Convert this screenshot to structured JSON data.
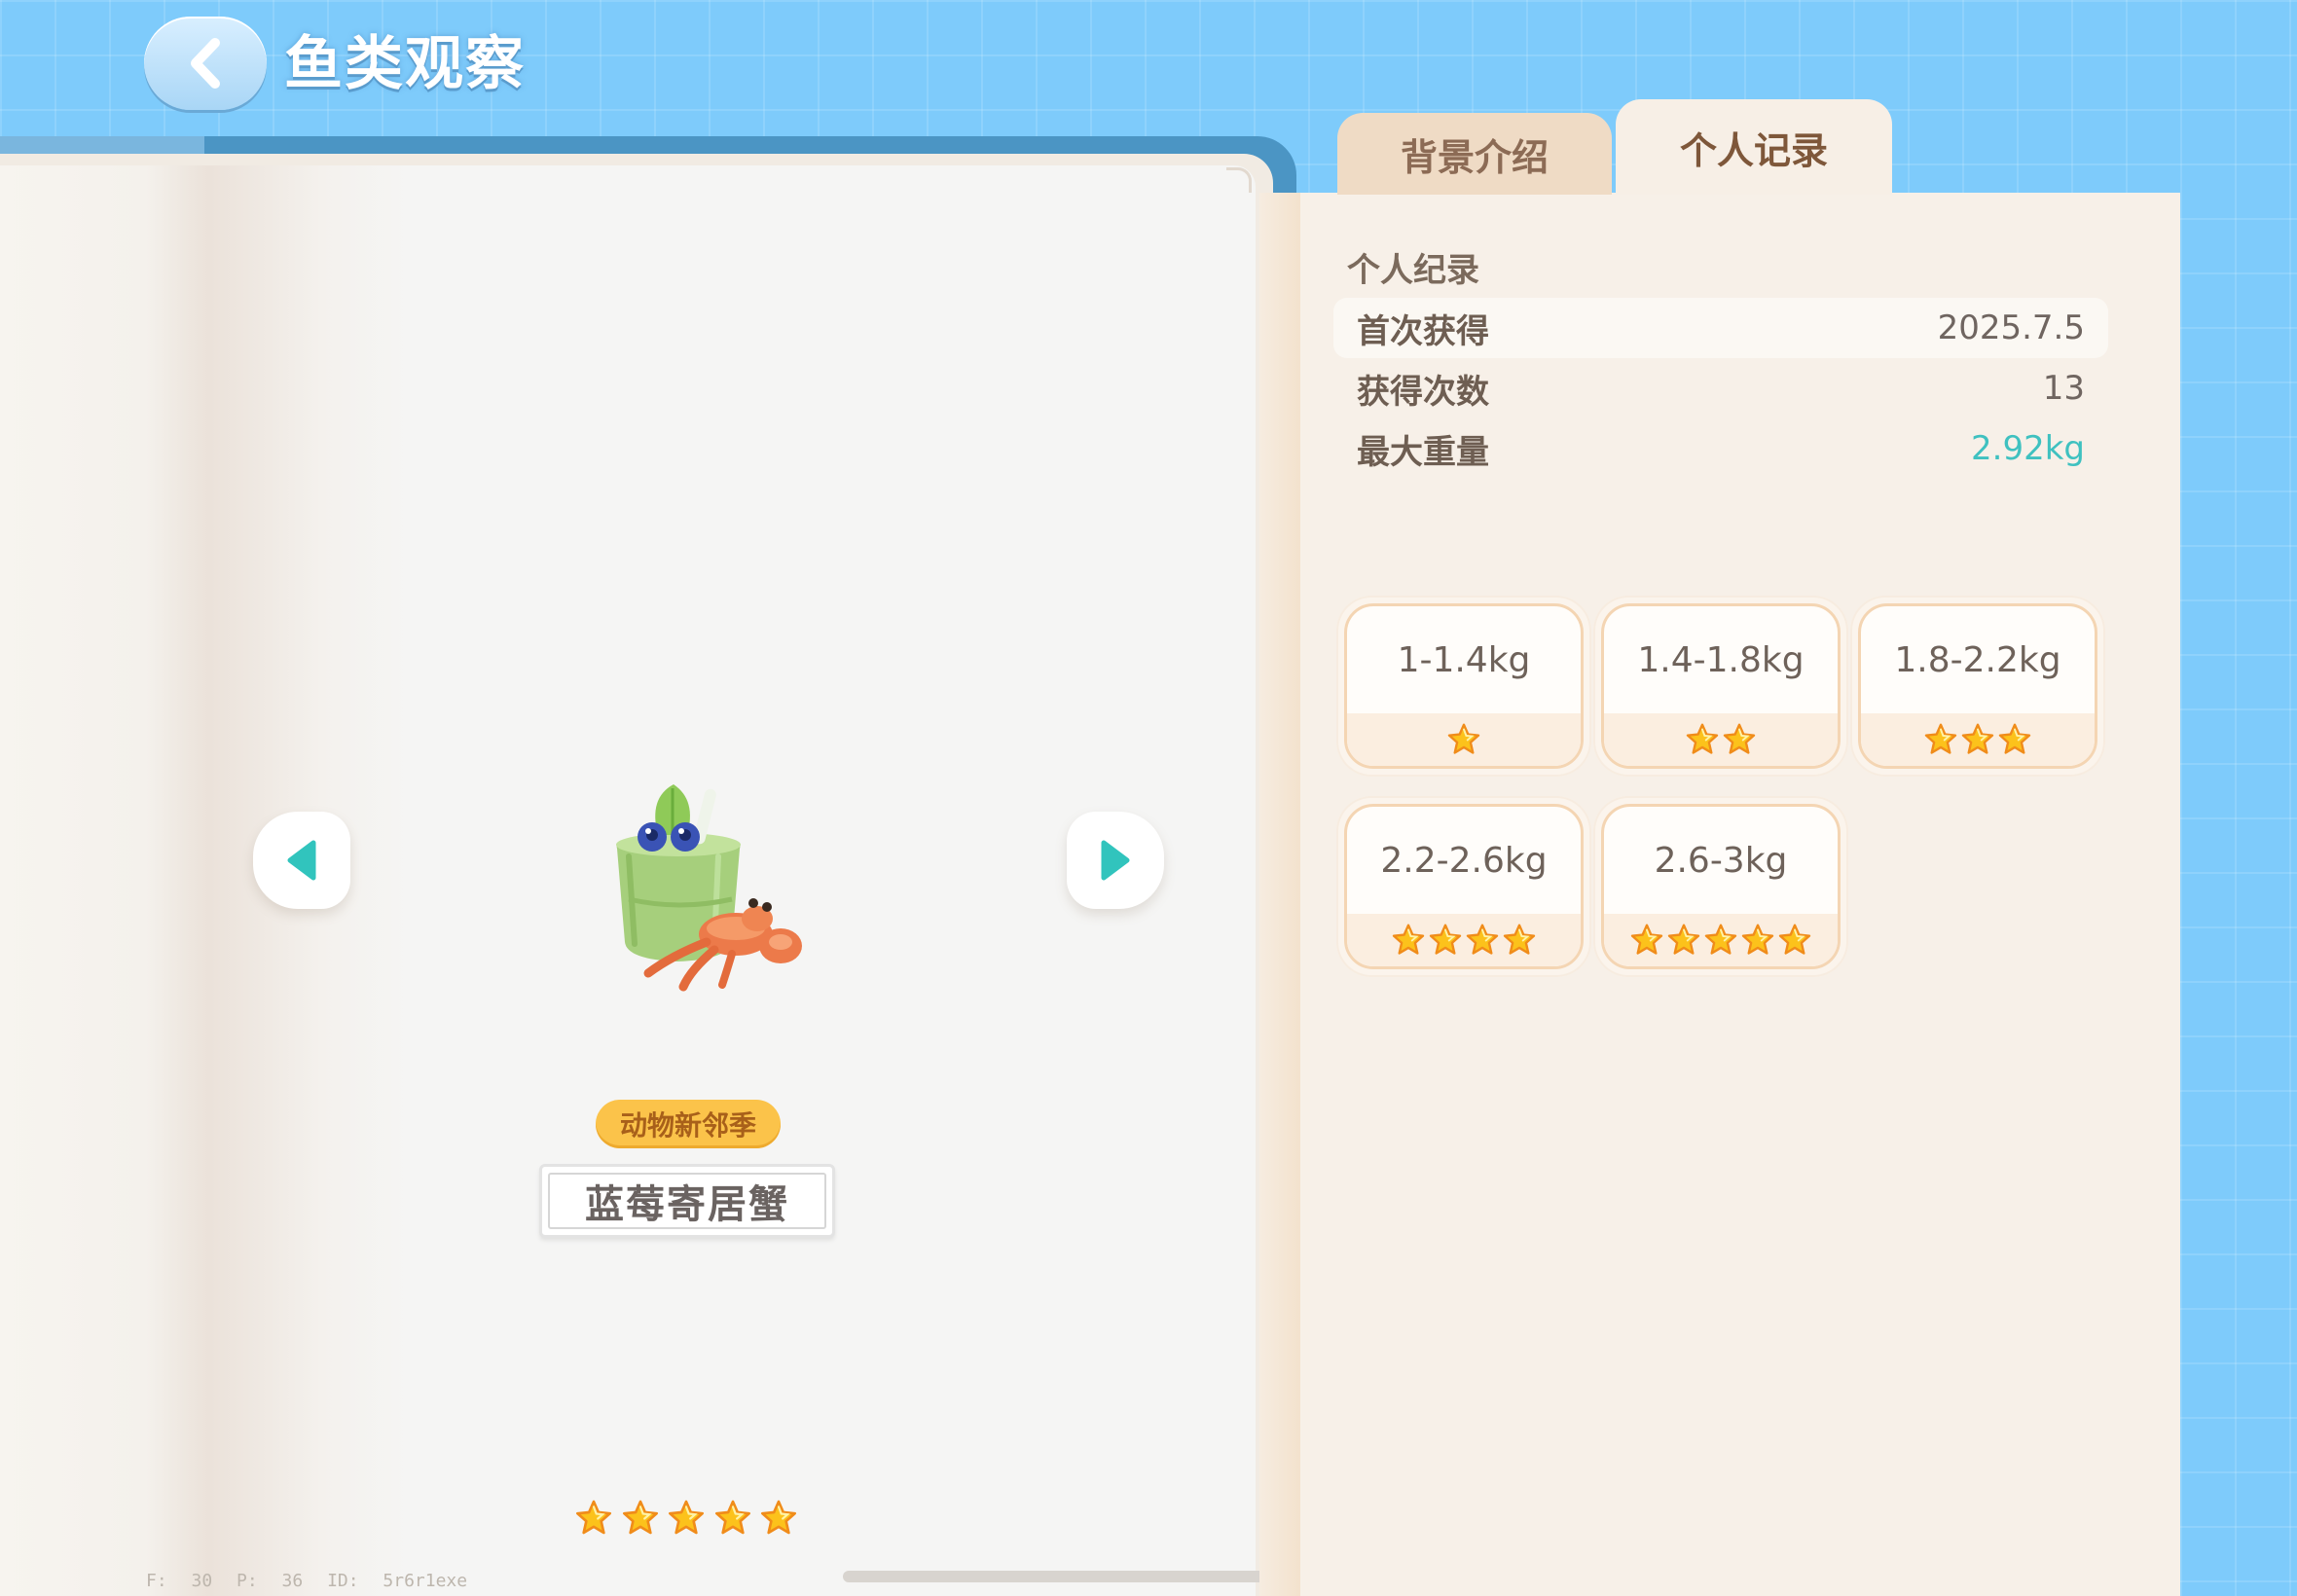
{
  "header": {
    "title": "鱼类观察",
    "back_icon": "chevron-left-icon"
  },
  "tabs": [
    {
      "label": "背景介绍",
      "active": false
    },
    {
      "label": "个人记录",
      "active": true
    }
  ],
  "creature": {
    "season_badge": "动物新邻季",
    "name": "蓝莓寄居蟹",
    "rarity_stars": 5
  },
  "record": {
    "heading": "个人纪录",
    "rows": [
      {
        "label": "首次获得",
        "value": "2025.7.5"
      },
      {
        "label": "获得次数",
        "value": "13"
      },
      {
        "label": "最大重量",
        "value": "2.92kg"
      }
    ]
  },
  "weight_tiers": [
    {
      "label": "1-1.4kg",
      "stars": 1
    },
    {
      "label": "1.4-1.8kg",
      "stars": 2
    },
    {
      "label": "1.8-2.2kg",
      "stars": 3
    },
    {
      "label": "2.2-2.6kg",
      "stars": 4
    },
    {
      "label": "2.6-3kg",
      "stars": 5
    }
  ],
  "debug": {
    "fps": "F: 30",
    "ping": "P: 36",
    "id": "ID: 5r6r1exe"
  },
  "colors": {
    "sky": "#7ecbfb",
    "accent_teal": "#3fc1c0",
    "star": "#fbc02d",
    "badge": "#fbc34a"
  }
}
